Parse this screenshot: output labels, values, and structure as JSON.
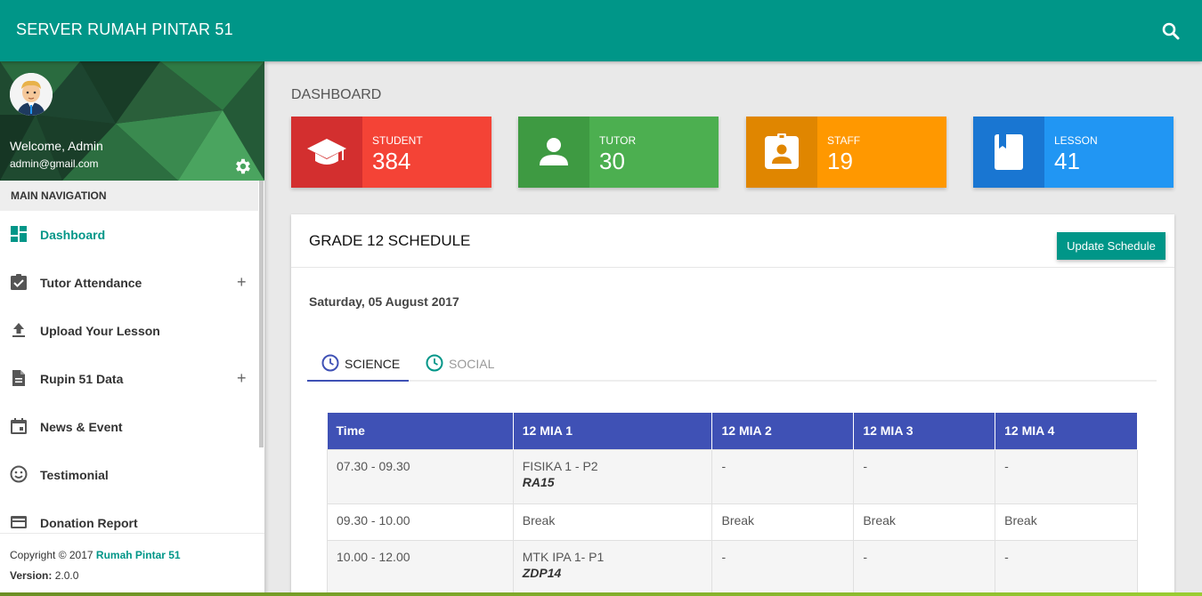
{
  "app": {
    "title": "SERVER RUMAH PINTAR 51"
  },
  "search": {
    "icon": "search-icon"
  },
  "user": {
    "welcome": "Welcome, Admin",
    "email": "admin@gmail.com"
  },
  "sidebar": {
    "header": "MAIN NAVIGATION",
    "items": [
      {
        "label": "Dashboard",
        "icon": "dashboard-icon",
        "active": true,
        "expandable": false
      },
      {
        "label": "Tutor Attendance",
        "icon": "clipboard-check-icon",
        "active": false,
        "expandable": true
      },
      {
        "label": "Upload Your Lesson",
        "icon": "upload-icon",
        "active": false,
        "expandable": false
      },
      {
        "label": "Rupin 51 Data",
        "icon": "document-icon",
        "active": false,
        "expandable": true
      },
      {
        "label": "News & Event",
        "icon": "calendar-icon",
        "active": false,
        "expandable": false
      },
      {
        "label": "Testimonial",
        "icon": "smiley-icon",
        "active": false,
        "expandable": false
      },
      {
        "label": "Donation Report",
        "icon": "credit-card-icon",
        "active": false,
        "expandable": false
      }
    ],
    "expand_symbol": "+"
  },
  "footer": {
    "copyright": "Copyright © 2017 ",
    "brand": "Rumah Pintar 51",
    "version_label": "Version:",
    "version_value": " 2.0.0"
  },
  "page": {
    "title": "DASHBOARD"
  },
  "stats": [
    {
      "label": "STUDENT",
      "value": "384",
      "color": "#f44336",
      "icon_bg": "#d32f2f",
      "icon": "graduation-cap-icon"
    },
    {
      "label": "TUTOR",
      "value": "30",
      "color": "#4caf50",
      "icon_bg": "#3e9a42",
      "icon": "person-icon"
    },
    {
      "label": "STAFF",
      "value": "19",
      "color": "#ff9800",
      "icon_bg": "#e08600",
      "icon": "badge-icon"
    },
    {
      "label": "LESSON",
      "value": "41",
      "color": "#2196f3",
      "icon_bg": "#1976d2",
      "icon": "book-icon"
    }
  ],
  "schedule": {
    "title": "GRADE 12 SCHEDULE",
    "update_label": "Update Schedule",
    "date": "Saturday, 05 August 2017",
    "tabs": [
      {
        "label": "SCIENCE",
        "active": true
      },
      {
        "label": "SOCIAL",
        "active": false
      }
    ],
    "columns": [
      "Time",
      "12 MIA 1",
      "12 MIA 2",
      "12 MIA 3",
      "12 MIA 4"
    ],
    "rows": [
      {
        "time": "07.30 - 09.30",
        "c1": "FISIKA 1 - P2",
        "c1_code": "RA15",
        "c2": "-",
        "c3": "-",
        "c4": "-"
      },
      {
        "time": "09.30 - 10.00",
        "c1": "Break",
        "c1_code": "",
        "c2": "Break",
        "c3": "Break",
        "c4": "Break"
      },
      {
        "time": "10.00 - 12.00",
        "c1": "MTK IPA 1- P1",
        "c1_code": "ZDP14",
        "c2": "-",
        "c3": "-",
        "c4": "-"
      }
    ]
  },
  "colors": {
    "primary": "#009688",
    "table_header": "#3f51b5"
  }
}
